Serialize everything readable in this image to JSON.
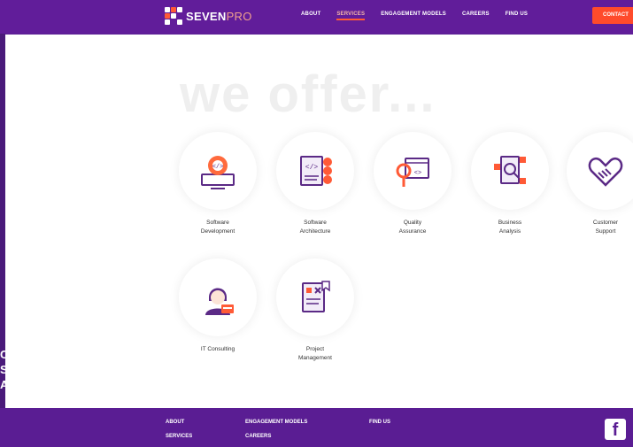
{
  "brand": {
    "name_main": "SEVEN",
    "name_suffix": "PRO"
  },
  "nav": {
    "items": [
      {
        "label": "ABOUT"
      },
      {
        "label": "SERVICES"
      },
      {
        "label": "ENGAGEMENT MODELS"
      },
      {
        "label": "CAREERS"
      },
      {
        "label": "FIND US"
      }
    ],
    "contact_label": "CONTACT"
  },
  "main": {
    "heading": "we offer...",
    "services": [
      {
        "label_line1": "Software",
        "label_line2": "Development",
        "icon": "software-development-icon"
      },
      {
        "label_line1": "Software",
        "label_line2": "Architecture",
        "icon": "software-architecture-icon"
      },
      {
        "label_line1": "Quality",
        "label_line2": "Assurance",
        "icon": "quality-assurance-icon"
      },
      {
        "label_line1": "Business",
        "label_line2": "Analysis",
        "icon": "business-analysis-icon"
      },
      {
        "label_line1": "Customer",
        "label_line2": "Support",
        "icon": "customer-support-icon"
      },
      {
        "label_line1": "IT Consulting",
        "label_line2": "",
        "icon": "it-consulting-icon"
      },
      {
        "label_line1": "Project",
        "label_line2": "Management",
        "icon": "project-management-icon"
      }
    ]
  },
  "left_fragment": {
    "lines": [
      "C",
      "S",
      "A"
    ]
  },
  "footer": {
    "links": {
      "about": "ABOUT",
      "services": "SERVICES",
      "engagement": "ENGAGEMENT MODELS",
      "careers": "CAREERS",
      "find_us": "FIND US"
    },
    "social_icon": "facebook-icon"
  },
  "colors": {
    "brand_purple": "#611d9a",
    "accent_orange": "#ff4b2b",
    "icon_purple": "#5b2a86"
  }
}
